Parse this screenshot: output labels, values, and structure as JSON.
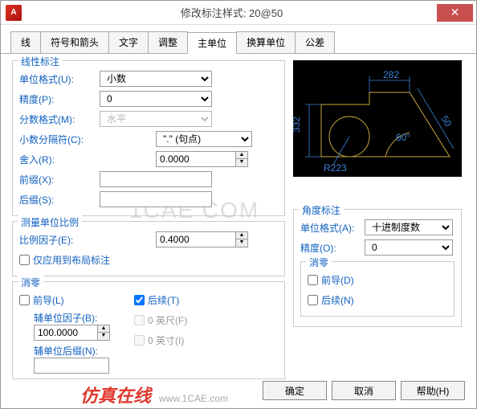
{
  "titlebar": {
    "icon": "A",
    "title": "修改标注样式: 20@50"
  },
  "tabs": [
    "线",
    "符号和箭头",
    "文字",
    "调整",
    "主单位",
    "换算单位",
    "公差"
  ],
  "active_tab": 4,
  "linear": {
    "legend": "线性标注",
    "unit_format_label": "单位格式(U):",
    "unit_format": "小数",
    "precision_label": "精度(P):",
    "precision": "0",
    "fraction_label": "分数格式(M):",
    "fraction": "水平",
    "decsep_label": "小数分隔符(C):",
    "decsep": "\".\"  (句点)",
    "round_label": "舍入(R):",
    "round": "0.0000",
    "prefix_label": "前缀(X):",
    "prefix": "",
    "suffix_label": "后缀(S):",
    "suffix": ""
  },
  "scale": {
    "legend": "测量单位比例",
    "factor_label": "比例因子(E):",
    "factor": "0.4000",
    "layout_only": "仅应用到布局标注"
  },
  "zero_l": {
    "legend": "消零",
    "leading": "前导(L)",
    "trailing": "后续(T)",
    "subfactor_label": "辅单位因子(B):",
    "subfactor": "100.0000",
    "feet": "0 英尺(F)",
    "inches": "0 英寸(I)",
    "subsuffix_label": "辅单位后缀(N):",
    "subsuffix": ""
  },
  "angular": {
    "legend": "角度标注",
    "unit_format_label": "单位格式(A):",
    "unit_format": "十进制度数",
    "precision_label": "精度(O):",
    "precision": "0"
  },
  "zero_a": {
    "legend": "消零",
    "leading": "前导(D)",
    "trailing": "后续(N)"
  },
  "preview": {
    "d1": "282",
    "d2": "332",
    "d3": "50",
    "d4": "60°",
    "r": "R223"
  },
  "buttons": {
    "ok": "确定",
    "cancel": "取消",
    "help": "帮助(H)"
  },
  "watermark": "1CAE  COM",
  "brand_cn": "仿真在线",
  "brand_en": "www.1CAE.com"
}
